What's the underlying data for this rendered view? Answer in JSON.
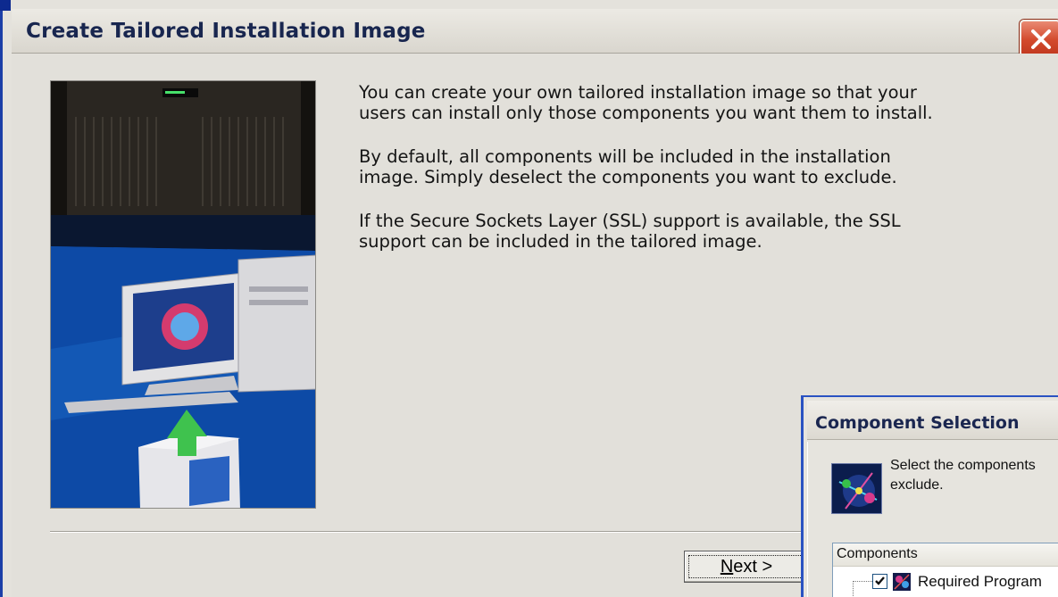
{
  "main_window": {
    "title": "Create Tailored Installation Image",
    "close_icon": "close-icon",
    "paragraphs": [
      "You can create your own tailored installation image so that your\nusers can install only those components you want them to install.",
      "By default, all components will be included in the installation\nimage.  Simply deselect the components you want to exclude.",
      "If the Secure Sockets Layer (SSL) support is available, the SSL\nsupport can be included in the tailored image."
    ],
    "next_button": {
      "mnemonic": "N",
      "rest": "ext >"
    },
    "illustration_icon": "installation-illustration"
  },
  "component_window": {
    "title": "Component Selection",
    "description": "Select the components\nexclude.",
    "list_header": "Components",
    "items": [
      {
        "label": "Required Program",
        "checked": true,
        "icon": "program-icon"
      }
    ]
  },
  "colors": {
    "title_text": "#18264f",
    "window_bg": "#e2e0da",
    "close_button": "#d34a2d",
    "illustration_blue": "#0c47a0",
    "border_blue": "#1c3fa8"
  }
}
